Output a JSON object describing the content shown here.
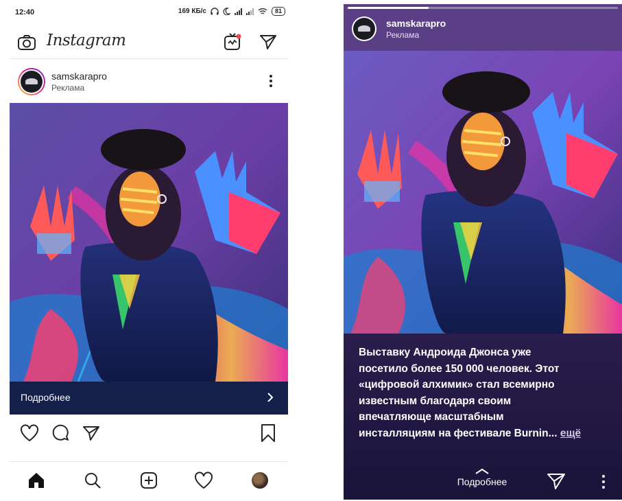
{
  "feed": {
    "status_bar": {
      "time": "12:40",
      "net_speed": "169 КБ/с",
      "battery": "81"
    },
    "topbar": {
      "logo_text": "Instagram",
      "camera_icon": "camera-icon",
      "igtv_icon": "igtv-icon",
      "direct_icon": "send-icon"
    },
    "post": {
      "account_name": "samskarapro",
      "sponsored_label": "Реклама",
      "cta_label": "Подробнее"
    },
    "actions": [
      "heart-icon",
      "comment-icon",
      "send-icon",
      "bookmark-icon"
    ],
    "bottom_nav": [
      "home-icon",
      "search-icon",
      "add-post-icon",
      "activity-heart-icon",
      "profile-icon"
    ]
  },
  "story": {
    "account_name": "samskarapro",
    "sponsored_label": "Реклама",
    "progress": 0.3,
    "caption_lines": [
      "Выставку Андроида Джонса уже",
      "посетило более 150 000 человек. Этот",
      "«цифровой алхимик» стал всемирно",
      "известным благодаря своим",
      "впечатляюще масштабным"
    ],
    "caption_last": "инсталляциям на фестивале Burnin...",
    "more_link": "ещё",
    "cta_label": "Подробнее"
  },
  "colors": {
    "cta_bar": "#14204a",
    "story_header": "#5b3f86",
    "story_bottom": "#1e1740",
    "notification_dot": "#ed4956"
  }
}
